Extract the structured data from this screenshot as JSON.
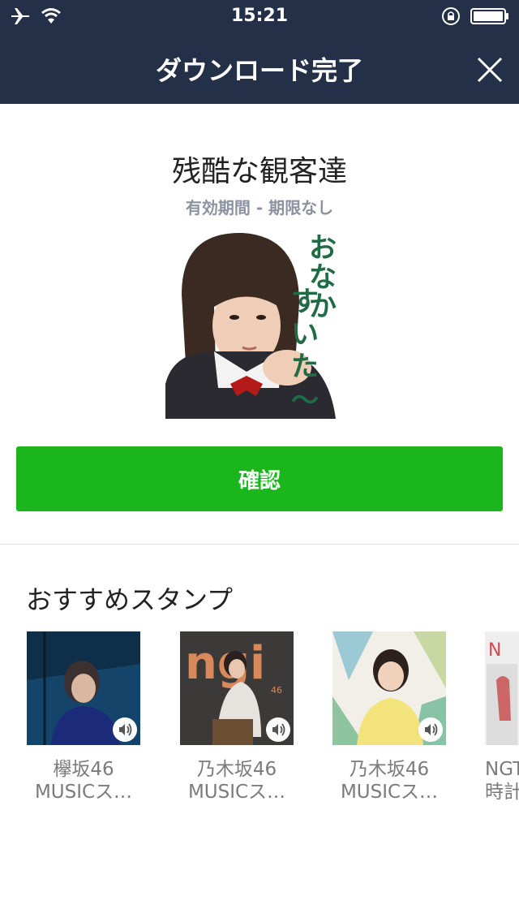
{
  "status_bar": {
    "time": "15:21"
  },
  "header": {
    "title": "ダウンロード完了"
  },
  "sticker": {
    "title": "残酷な観客達",
    "validity": "有効期間 - 期限なし",
    "image_caption": "おなかすいた〜"
  },
  "confirm_button": {
    "label": "確認"
  },
  "recommended": {
    "title": "おすすめスタンプ",
    "items": [
      {
        "line1": "欅坂46",
        "line2": "MUSICス…"
      },
      {
        "line1": "乃木坂46",
        "line2": "MUSICス…"
      },
      {
        "line1": "乃木坂46",
        "line2": "MUSICス…"
      },
      {
        "line1": "NGT",
        "line2": "時計"
      }
    ]
  },
  "colors": {
    "header_bg": "#243047",
    "confirm_bg": "#1ab61c"
  }
}
